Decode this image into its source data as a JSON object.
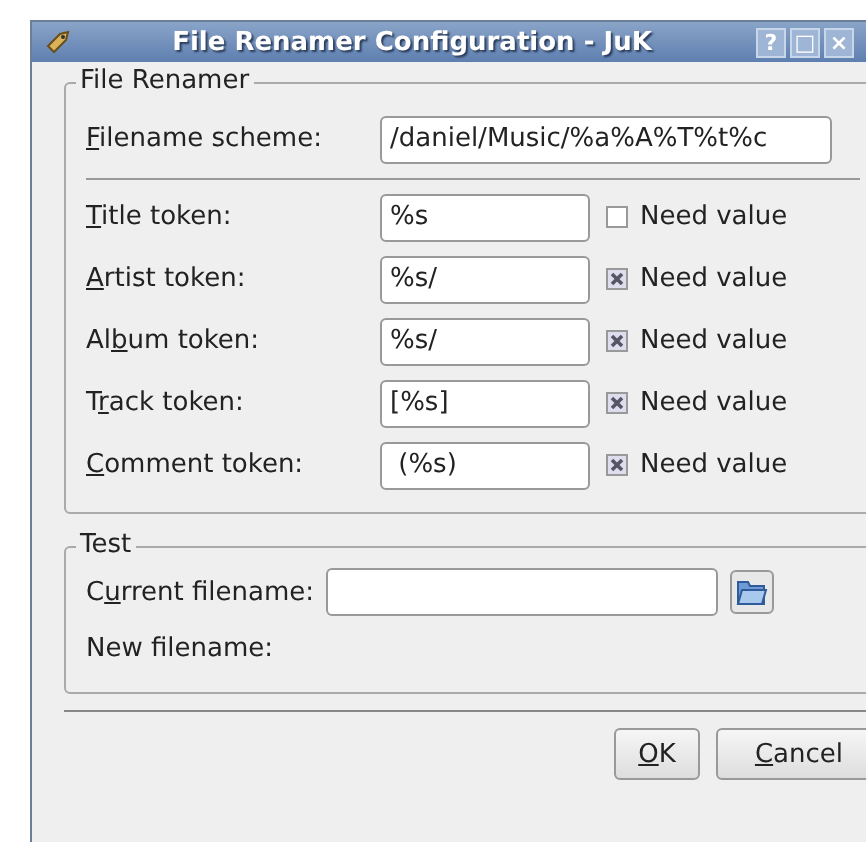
{
  "window": {
    "title": "File Renamer Configuration - JuK",
    "buttons": [
      "?",
      "□",
      "×"
    ]
  },
  "file_renamer": {
    "title": "File Renamer",
    "scheme": {
      "label": {
        "key": "F",
        "post": "ilename scheme:"
      },
      "value": "/daniel/Music/%a%A%T%t%c"
    },
    "tokens": [
      {
        "label": {
          "key": "T",
          "post": "itle token:"
        },
        "value": "%s",
        "need_value": "Need value",
        "checked": false
      },
      {
        "label": {
          "key": "A",
          "post": "rtist token:"
        },
        "value": "%s/",
        "need_value": "Need value",
        "checked": true
      },
      {
        "label": {
          "pre": "Al",
          "key": "b",
          "post": "um token:"
        },
        "value": "%s/",
        "need_value": "Need value",
        "checked": true
      },
      {
        "label": {
          "pre": "T",
          "key": "r",
          "post": "ack token:"
        },
        "value": "[%s]",
        "need_value": "Need value",
        "checked": true
      },
      {
        "label": {
          "key": "C",
          "post": "omment token:"
        },
        "value": " (%s)",
        "need_value": "Need value",
        "checked": true
      }
    ]
  },
  "test": {
    "title": "Test",
    "current": {
      "label": {
        "pre": "C",
        "key": "u",
        "post": "rrent filename:"
      }
    },
    "new_filename": "New filename:"
  },
  "buttons": [
    {
      "label": {
        "key": "O",
        "post": "K"
      }
    },
    {
      "label": {
        "key": "C",
        "post": "ancel"
      }
    }
  ]
}
